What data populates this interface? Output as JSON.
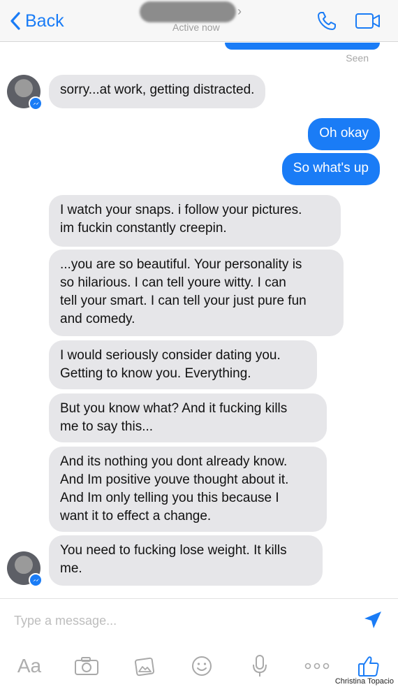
{
  "header": {
    "back_label": "Back",
    "status": "Active now",
    "accent_color": "#1a7cf6"
  },
  "thread": {
    "seen_label": "Seen",
    "messages": [
      {
        "sender": "them",
        "text": "sorry...at work, getting distracted."
      },
      {
        "sender": "me",
        "text": "Oh okay"
      },
      {
        "sender": "me",
        "text": "So what's up"
      },
      {
        "sender": "them",
        "lines": [
          "I watch your snaps. i follow your pictures.",
          "im fuckin constantly creepin."
        ]
      },
      {
        "sender": "them",
        "lines": [
          "...you are so beautiful. Your personality is",
          "so hilarious. I can tell youre witty. I can",
          "tell your smart. I can tell your just pure fun",
          "and comedy."
        ]
      },
      {
        "sender": "them",
        "lines": [
          "I would seriously consider dating you.",
          "Getting to know you. Everything."
        ]
      },
      {
        "sender": "them",
        "lines": [
          "But you know what? And it fucking kills",
          "me to say this..."
        ]
      },
      {
        "sender": "them",
        "lines": [
          "And its nothing you dont already know.",
          "And Im positive youve thought about it.",
          "And Im only telling you this because I",
          "want it to effect a change."
        ]
      },
      {
        "sender": "them",
        "lines": [
          "You need to fucking lose weight. It kills",
          "me."
        ]
      }
    ]
  },
  "composer": {
    "placeholder": "Type a message...",
    "toolbar": {
      "text_label": "Aa",
      "icons": [
        "camera-icon",
        "photo-icon",
        "emoji-icon",
        "microphone-icon",
        "more-icon",
        "like-icon"
      ]
    }
  },
  "credit": "Christina Topacio"
}
